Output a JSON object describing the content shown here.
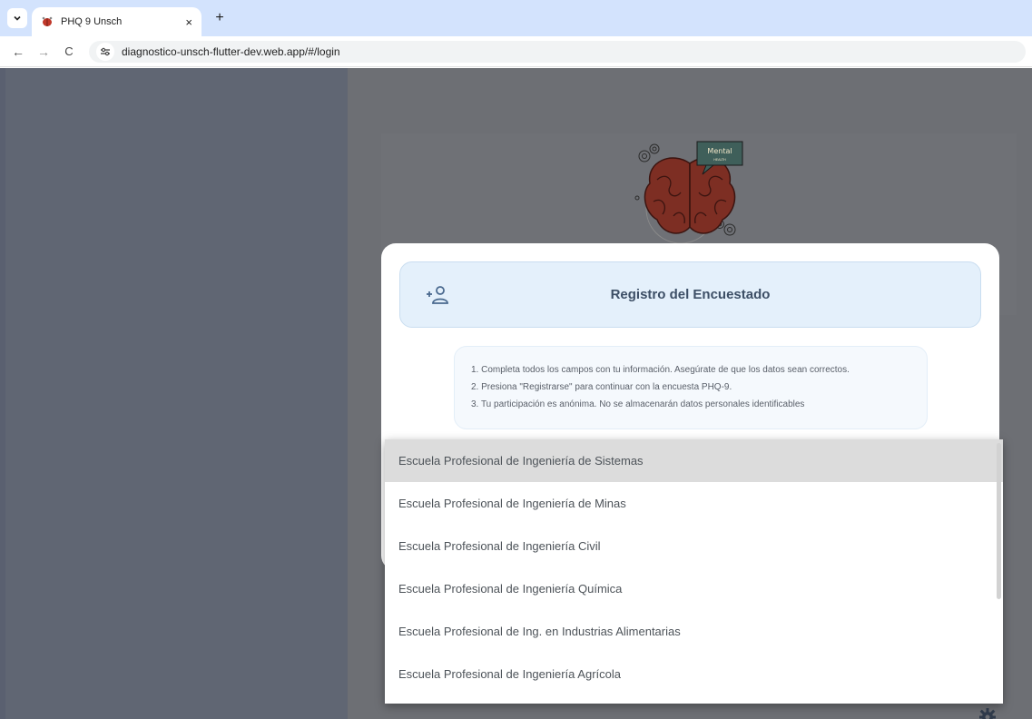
{
  "browser": {
    "tab_title": "PHQ 9 Unsch",
    "tab_close": "×",
    "new_tab": "+",
    "url": "diagnostico-unsch-flutter-dev.web.app/#/login",
    "back": "←",
    "forward": "→",
    "reload": "C"
  },
  "logo": {
    "sign_text": "Mental",
    "sign_subtext": "HEALTH"
  },
  "registration": {
    "title": "Registro del Encuestado",
    "icon": "person-add-icon",
    "instructions": [
      "1. Completa todos los campos con tu información. Asegúrate de que los datos sean correctos.",
      "2. Presiona \"Registrarse\" para continuar con la encuesta PHQ-9.",
      "3. Tu participación es anónima. No se almacenarán datos personales identificables"
    ]
  },
  "dropdown": {
    "options": [
      "Escuela Profesional de Ingeniería de Sistemas",
      "Escuela Profesional de Ingeniería de Minas",
      "Escuela Profesional de Ingeniería Civil",
      "Escuela Profesional de Ingeniería Química",
      "Escuela Profesional de Ing. en Industrias Alimentarias",
      "Escuela Profesional de Ingeniería Agrícola"
    ],
    "selected_index": 0
  },
  "colors": {
    "header_bg": "#e4f0fb",
    "title_text": "#3d4f66",
    "selected_option": "#dcdcdc",
    "left_panel": "#606673"
  }
}
